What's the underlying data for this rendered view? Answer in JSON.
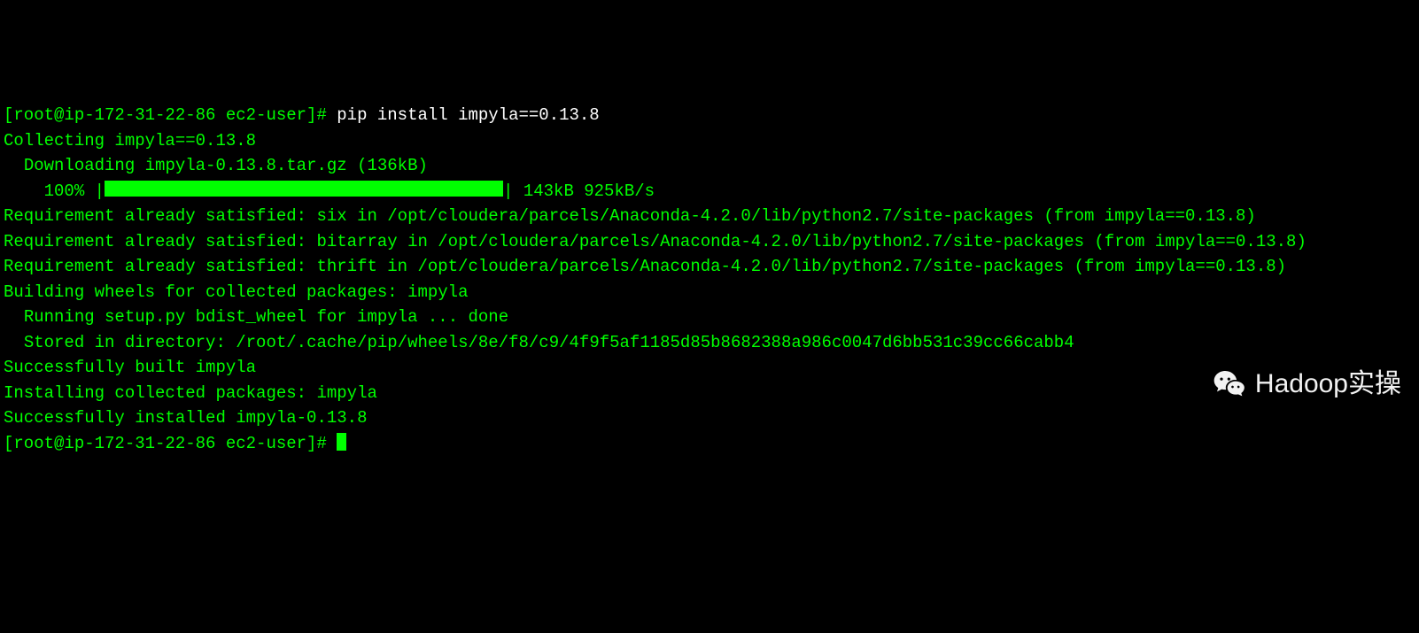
{
  "prompt1": {
    "user_host": "[root@ip-172-31-22-86 ec2-user]#",
    "command": "pip install impyla==0.13.8"
  },
  "lines": {
    "collecting": "Collecting impyla==0.13.8",
    "downloading": "  Downloading impyla-0.13.8.tar.gz (136kB)",
    "progress_pct": "    100% |",
    "progress_end": "| 143kB 925kB/s",
    "req_six": "Requirement already satisfied: six in /opt/cloudera/parcels/Anaconda-4.2.0/lib/python2.7/site-packages (from impyla==0.13.8)",
    "req_bitarray": "Requirement already satisfied: bitarray in /opt/cloudera/parcels/Anaconda-4.2.0/lib/python2.7/site-packages (from impyla==0.13.8)",
    "req_thrift": "Requirement already satisfied: thrift in /opt/cloudera/parcels/Anaconda-4.2.0/lib/python2.7/site-packages (from impyla==0.13.8)",
    "building": "Building wheels for collected packages: impyla",
    "running": "  Running setup.py bdist_wheel for impyla ... done",
    "stored": "  Stored in directory: /root/.cache/pip/wheels/8e/f8/c9/4f9f5af1185d85b8682388a986c0047d6bb531c39cc66cabb4",
    "built": "Successfully built impyla",
    "installing": "Installing collected packages: impyla",
    "installed": "Successfully installed impyla-0.13.8"
  },
  "prompt2": {
    "user_host": "[root@ip-172-31-22-86 ec2-user]#",
    "command": ""
  },
  "watermark": {
    "text": "Hadoop实操"
  }
}
